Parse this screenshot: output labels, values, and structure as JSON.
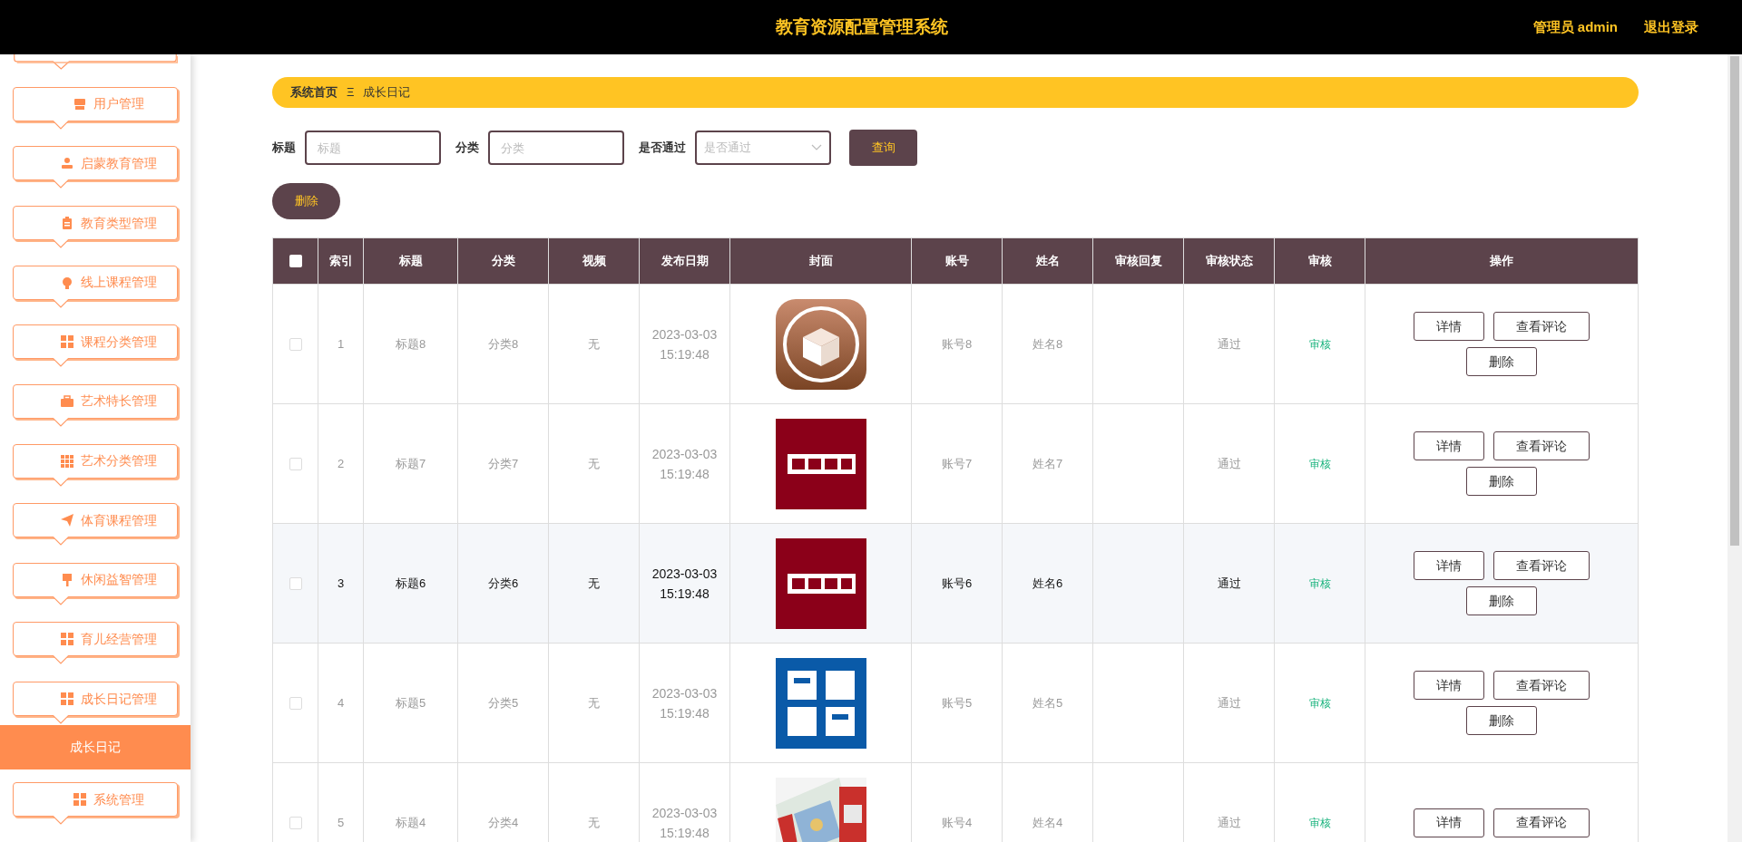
{
  "header": {
    "title": "教育资源配置管理系统",
    "user": "管理员 admin",
    "logout": "退出登录"
  },
  "sidebar": {
    "items": [
      {
        "label": "用户管理",
        "selected": false
      },
      {
        "label": "启蒙教育管理",
        "selected": false
      },
      {
        "label": "教育类型管理",
        "selected": false
      },
      {
        "label": "线上课程管理",
        "selected": false
      },
      {
        "label": "课程分类管理",
        "selected": false
      },
      {
        "label": "艺术特长管理",
        "selected": false
      },
      {
        "label": "艺术分类管理",
        "selected": false
      },
      {
        "label": "体育课程管理",
        "selected": false
      },
      {
        "label": "休闲益智管理",
        "selected": false
      },
      {
        "label": "育儿经营管理",
        "selected": false
      },
      {
        "label": "成长日记管理",
        "selected": false
      },
      {
        "label": "成长日记",
        "selected": true,
        "kind": "sub"
      },
      {
        "label": "系统管理",
        "selected": false
      }
    ]
  },
  "breadcrumb": {
    "home": "系统首页",
    "separator": "Ξ",
    "current": "成长日记"
  },
  "search": {
    "fields": [
      {
        "label": "标题",
        "placeholder": "标题",
        "kind": "input"
      },
      {
        "label": "分类",
        "placeholder": "分类",
        "kind": "input"
      },
      {
        "label": "是否通过",
        "placeholder": "是否通过",
        "kind": "select"
      }
    ],
    "button": "查询"
  },
  "delete_button": "删除",
  "table": {
    "select_all_checked": false,
    "columns": [
      "索引",
      "标题",
      "分类",
      "视频",
      "发布日期",
      "封面",
      "账号",
      "姓名",
      "审核回复",
      "审核状态",
      "审核",
      "操作"
    ],
    "rows": [
      {
        "index": "1",
        "title": "标题8",
        "category": "分类8",
        "video": "无",
        "date": "2023-03-03 15:19:48",
        "account": "账号8",
        "name": "姓名8",
        "status": "通过",
        "review": "审核",
        "highlighted": false,
        "checked": false,
        "actions": [
          "详情",
          "查看评论",
          "删除"
        ]
      },
      {
        "index": "2",
        "title": "标题7",
        "category": "分类7",
        "video": "无",
        "date": "2023-03-03 15:19:48",
        "account": "账号7",
        "name": "姓名7",
        "status": "通过",
        "review": "审核",
        "highlighted": false,
        "checked": false,
        "actions": [
          "详情",
          "查看评论",
          "删除"
        ]
      },
      {
        "index": "3",
        "title": "标题6",
        "category": "分类6",
        "video": "无",
        "date": "2023-03-03 15:19:48",
        "account": "账号6",
        "name": "姓名6",
        "status": "通过",
        "review": "审核",
        "highlighted": true,
        "checked": false,
        "actions": [
          "详情",
          "查看评论",
          "删除"
        ]
      },
      {
        "index": "4",
        "title": "标题5",
        "category": "分类5",
        "video": "无",
        "date": "2023-03-03 15:19:48",
        "account": "账号5",
        "name": "姓名5",
        "status": "通过",
        "review": "审核",
        "highlighted": false,
        "checked": false,
        "actions": [
          "详情",
          "查看评论",
          "删除"
        ]
      },
      {
        "index": "5",
        "title": "标题4",
        "category": "分类4",
        "video": "无",
        "date": "2023-03-03 15:19:48",
        "account": "账号4",
        "name": "姓名4",
        "status": "通过",
        "review": "审核",
        "highlighted": false,
        "checked": false,
        "actions": [
          "详情",
          "查看评论"
        ]
      }
    ]
  }
}
